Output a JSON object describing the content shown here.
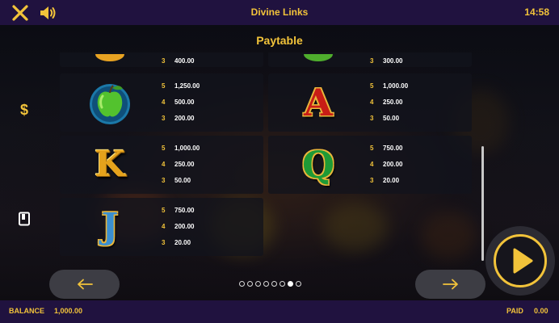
{
  "header": {
    "title": "Divine Links",
    "time": "14:58",
    "close_icon": "close-icon",
    "sound_icon": "speaker-icon"
  },
  "panel": {
    "title": "Paytable"
  },
  "sidebar": {
    "coin_icon": "dollar-icon",
    "rules_icon": "book-icon"
  },
  "paytable": {
    "top_partial": [
      {
        "count": "3",
        "value": "400.00"
      },
      {
        "count": "3",
        "value": "300.00"
      }
    ],
    "symbols": [
      {
        "symbol": "apple-icon",
        "rows": [
          {
            "count": "5",
            "value": "1,250.00"
          },
          {
            "count": "4",
            "value": "500.00"
          },
          {
            "count": "3",
            "value": "200.00"
          }
        ]
      },
      {
        "symbol": "A",
        "rows": [
          {
            "count": "5",
            "value": "1,000.00"
          },
          {
            "count": "4",
            "value": "250.00"
          },
          {
            "count": "3",
            "value": "50.00"
          }
        ]
      },
      {
        "symbol": "K",
        "rows": [
          {
            "count": "5",
            "value": "1,000.00"
          },
          {
            "count": "4",
            "value": "250.00"
          },
          {
            "count": "3",
            "value": "50.00"
          }
        ]
      },
      {
        "symbol": "Q",
        "rows": [
          {
            "count": "5",
            "value": "750.00"
          },
          {
            "count": "4",
            "value": "200.00"
          },
          {
            "count": "3",
            "value": "20.00"
          }
        ]
      },
      {
        "symbol": "J",
        "rows": [
          {
            "count": "5",
            "value": "750.00"
          },
          {
            "count": "4",
            "value": "200.00"
          },
          {
            "count": "3",
            "value": "20.00"
          }
        ]
      }
    ]
  },
  "navigation": {
    "prev_icon": "arrow-left-icon",
    "next_icon": "arrow-right-icon",
    "play_icon": "play-icon",
    "page_count": 8,
    "active_page": 7
  },
  "footer": {
    "balance_label": "BALANCE",
    "balance_value": "1,000.00",
    "paid_label": "PAID",
    "paid_value": "0.00"
  },
  "colors": {
    "accent": "#f2c33a",
    "bar": "#20123f",
    "value_text": "#ffffff"
  }
}
